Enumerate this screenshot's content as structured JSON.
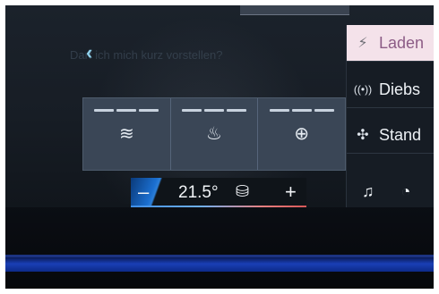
{
  "header": {
    "back_icon": "chevron-left-icon",
    "faded_prompt": "Darf ich mich kurz vorstellen?"
  },
  "seat_controls": [
    {
      "id": "seat-ventilation",
      "icon": "seat-ventilation-icon",
      "glyph": "≋"
    },
    {
      "id": "seat-heating",
      "icon": "seat-heating-icon",
      "glyph": "♨"
    },
    {
      "id": "steering-wheel-heating",
      "icon": "steering-wheel-heating-icon",
      "glyph": "⊕"
    }
  ],
  "climate": {
    "minus_label": "–",
    "temperature": "21.5°",
    "seat_icon": "seat-climate-icon",
    "plus_label": "+"
  },
  "side_menu": {
    "items": [
      {
        "label": "Laden",
        "icon": "charging-icon",
        "glyph": "⚡",
        "active": true
      },
      {
        "label": "Diebs",
        "icon": "anti-theft-icon",
        "glyph": "((•))",
        "active": false
      },
      {
        "label": "Stand",
        "icon": "fan-icon",
        "glyph": "✣",
        "active": false
      }
    ]
  },
  "bottom_bar": {
    "music_icon": "music-note-icon",
    "music_glyph": "♫",
    "phone_icon": "partial-circle-icon",
    "phone_glyph": "◔"
  },
  "colors": {
    "accent_blue": "#1b6fd0",
    "active_menu_bg": "#f4e2ea",
    "ambient_blue": "#1a3fb6"
  }
}
